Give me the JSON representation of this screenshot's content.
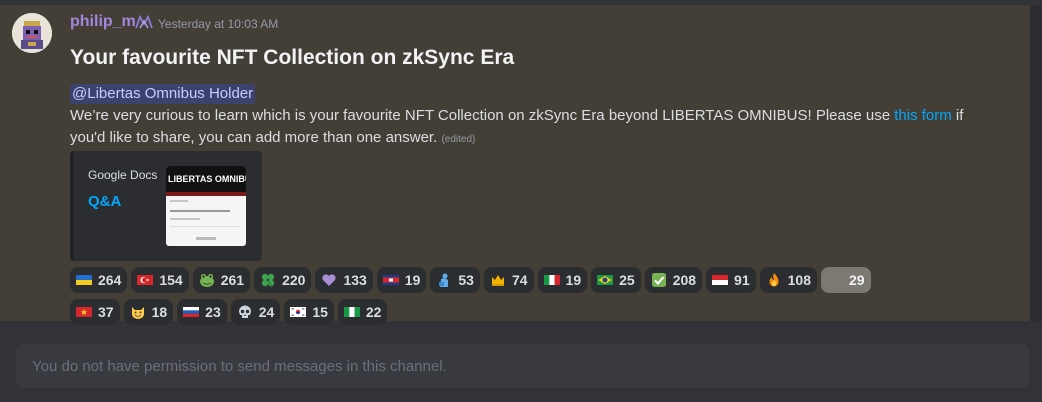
{
  "message": {
    "username": "philip_m",
    "timestamp": "Yesterday at 10:03 AM",
    "title": "Your favourite NFT Collection on zkSync Era",
    "mention": "@Libertas Omnibus Holder",
    "body_before_link": "We’re very curious to learn which is your favourite NFT Collection on zkSync Era beyond LIBERTAS OMNIBUS! Please use ",
    "link_text": "this form",
    "body_after_link": " if you'd like to share, you can add more than one answer.",
    "edited_label": "(edited)"
  },
  "embed": {
    "provider": "Google Docs",
    "title": "Q&A",
    "thumbnail_heading": "LIBERTAS OMNIBUS"
  },
  "reactions": [
    {
      "icon": "flag-ukraine-icon",
      "count": "264"
    },
    {
      "icon": "flag-turkey-icon",
      "count": "154"
    },
    {
      "icon": "frog-icon",
      "count": "261"
    },
    {
      "icon": "four-leaf-clover-icon",
      "count": "220"
    },
    {
      "icon": "purple-heart-icon",
      "count": "133"
    },
    {
      "icon": "flag-cambodia-icon",
      "count": "19"
    },
    {
      "icon": "blue-figure-icon",
      "count": "53"
    },
    {
      "icon": "crown-icon",
      "count": "74"
    },
    {
      "icon": "flag-italy-icon",
      "count": "19"
    },
    {
      "icon": "flag-brazil-icon",
      "count": "25"
    },
    {
      "icon": "check-mark-icon",
      "count": "208"
    },
    {
      "icon": "flag-indonesia-icon",
      "count": "91"
    },
    {
      "icon": "fire-icon",
      "count": "108"
    },
    {
      "icon": "blank-icon",
      "count": "29",
      "highlighted": true
    },
    {
      "icon": "flag-vietnam-icon",
      "count": "37"
    },
    {
      "icon": "grinning-cat-icon",
      "count": "18"
    },
    {
      "icon": "flag-russia-icon",
      "count": "23"
    },
    {
      "icon": "skull-icon",
      "count": "24"
    },
    {
      "icon": "flag-south-korea-icon",
      "count": "15"
    },
    {
      "icon": "flag-nigeria-icon",
      "count": "22"
    }
  ],
  "composer": {
    "placeholder": "You do not have permission to send messages in this channel."
  }
}
